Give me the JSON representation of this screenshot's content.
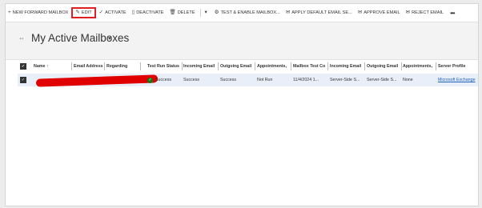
{
  "toolbar": {
    "items": [
      {
        "icon": "+",
        "label": "NEW FORWARD MAILBOX"
      },
      {
        "icon": "✎",
        "label": "EDIT"
      },
      {
        "icon": "✓",
        "label": "ACTIVATE"
      },
      {
        "icon": "▯",
        "label": "DEACTIVATE"
      },
      {
        "icon": "🗑",
        "label": "DELETE"
      },
      {
        "icon": "⚙",
        "label": "TEST & ENABLE MAILBOX..."
      },
      {
        "icon": "✉",
        "label": "APPLY DEFAULT EMAIL SE..."
      },
      {
        "icon": "✉",
        "label": "APPROVE EMAIL"
      },
      {
        "icon": "✉",
        "label": "REJECT EMAIL"
      }
    ],
    "dropdown_glyph": "▾",
    "more_glyph": "•••"
  },
  "view": {
    "title": "My Active Mailboxes",
    "chevron": "▾",
    "icon_glyph": "⇔"
  },
  "grid": {
    "columns": [
      "Name ↑",
      "Email Address",
      "Regarding",
      "Test Run Status",
      "Incoming Email",
      "Outgoing Email",
      "Appointments,",
      "Mailbox Test Co",
      "Incoming Email",
      "Outgoing Email",
      "Appointments,",
      "Server Profile"
    ],
    "rows": [
      {
        "test_run_status": "Success",
        "incoming_status": "Success",
        "outgoing_status": "Success",
        "appointments_status": "Not Run",
        "mailbox_test_completed": "11/4/2024 1...",
        "incoming_delivery": "Server-Side S...",
        "outgoing_delivery": "Server-Side S...",
        "appointments_sync": "None",
        "server_profile": "Microsoft Exchange"
      }
    ]
  },
  "colors": {
    "highlight": "#e02020",
    "redaction": "#e00000",
    "success": "#107c10",
    "link": "#1a5fb4",
    "selected_row": "#e9eff9"
  }
}
